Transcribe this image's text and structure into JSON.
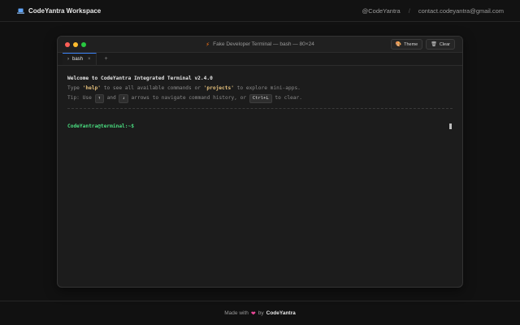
{
  "header": {
    "brand": "CodeYantra Workspace",
    "handle": "@CodeYantra",
    "separator": "/",
    "email": "contact.codeyantra@gmail.com"
  },
  "terminal": {
    "title": "Fake Developer Terminal — bash — 80×24",
    "theme_label": "Theme",
    "clear_label": "Clear",
    "tabs": [
      {
        "label": "bash",
        "active": true
      }
    ],
    "add_tab": "+",
    "welcome": "Welcome to CodeYantra Integrated Terminal v2.4.0",
    "line2": {
      "pre": "Type ",
      "cmd1": "'help'",
      "mid": " to see all available commands or ",
      "cmd2": "'projects'",
      "post": " to explore mini-apps."
    },
    "line3": {
      "pre": "Tip: Use ",
      "key_up": "↑",
      "and": " and ",
      "key_down": "↓",
      "mid": " arrows to navigate command history, or ",
      "key_clear": "Ctrl+L",
      "post": " to clear."
    },
    "prompt": "CodeYantra@terminal:~$"
  },
  "footer": {
    "made_with": "Made with",
    "by": "by",
    "brand": "CodeYantra"
  },
  "icons": {
    "brand": "laptop-icon",
    "title": "bolt-icon",
    "theme": "palette-icon",
    "clear": "trash-icon",
    "heart": "heart-icon"
  },
  "colors": {
    "accent": "#3b82f6",
    "prompt": "#4ade80",
    "keyword": "#e5c07b",
    "heart": "#ec4899"
  }
}
